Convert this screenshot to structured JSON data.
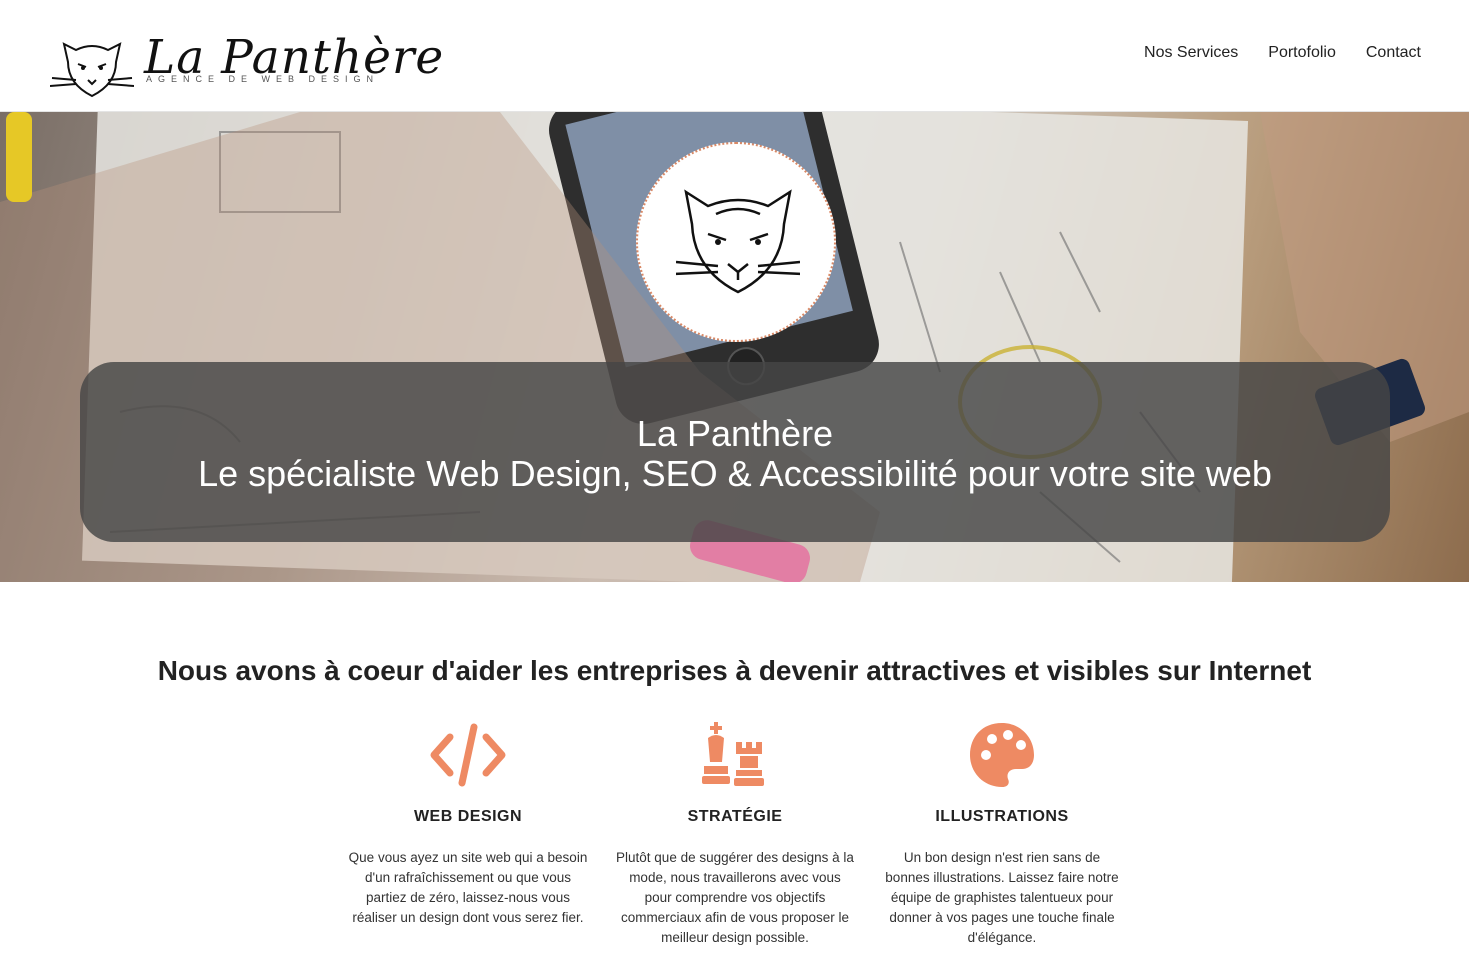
{
  "header": {
    "logo_name": "La Panthère",
    "logo_tagline": "AGENCE DE WEB DESIGN",
    "nav": [
      "Nos Services",
      "Portofolio",
      "Contact"
    ]
  },
  "hero": {
    "title": "La Panthère",
    "subtitle": "Le spécialiste Web Design, SEO & Accessibilité pour votre site web"
  },
  "intro": {
    "heading": "Nous avons à coeur d'aider les entreprises à devenir attractives et visibles sur Internet"
  },
  "services": [
    {
      "icon": "code-icon",
      "title": "WEB DESIGN",
      "text": "Que vous ayez un site web qui a besoin d'un rafraîchissement ou que vous partiez de zéro, laissez-nous vous réaliser un design dont vous serez fier."
    },
    {
      "icon": "chess-icon",
      "title": "STRATÉGIE",
      "text": "Plutôt que de suggérer des designs à la mode, nous travaillerons avec vous pour comprendre vos objectifs commerciaux afin de vous proposer le meilleur design possible."
    },
    {
      "icon": "palette-icon",
      "title": "ILLUSTRATIONS",
      "text": "Un bon design n'est rien sans de bonnes illustrations. Laissez faire notre équipe de graphistes talentueux pour donner à vos pages une touche finale d'élégance."
    }
  ],
  "colors": {
    "accent": "#ee8a63",
    "hero_panel": "#464646"
  }
}
